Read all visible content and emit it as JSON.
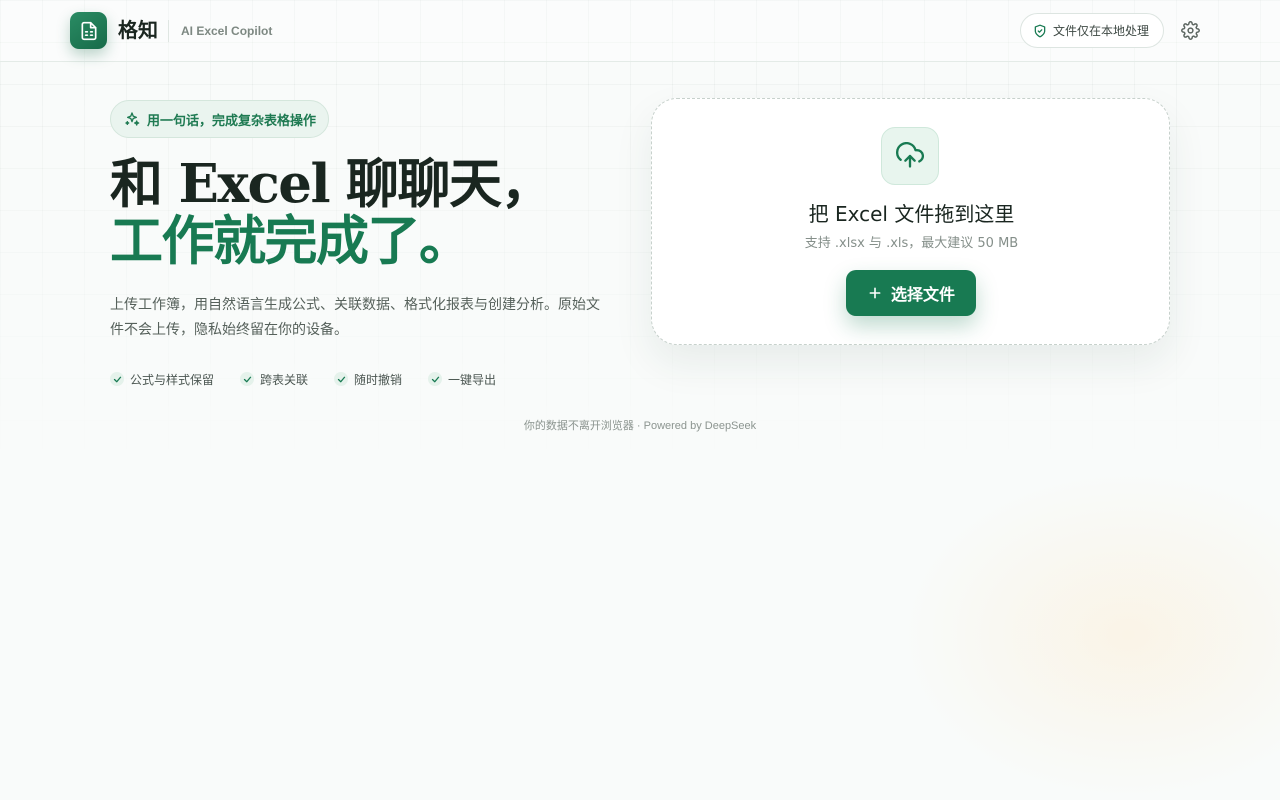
{
  "header": {
    "brand_name": "格知",
    "brand_subtitle": "AI Excel Copilot",
    "logo_icon": "spreadsheet-icon",
    "local_badge": "文件仅在本地处理",
    "local_badge_icon": "shield-check-icon",
    "settings_icon": "gear-icon"
  },
  "hero": {
    "tag": "用一句话，完成复杂表格操作",
    "tag_icon": "sparkles-icon",
    "headline_line1": "和 Excel 聊聊天，",
    "headline_line2": "工作就完成了。",
    "description": "上传工作簿，用自然语言生成公式、关联数据、格式化报表与创建分析。原始文件不会上传，隐私始终留在你的设备。",
    "features": [
      {
        "label": "公式与样式保留",
        "icon": "check-icon"
      },
      {
        "label": "跨表关联",
        "icon": "check-icon"
      },
      {
        "label": "随时撤销",
        "icon": "check-icon"
      },
      {
        "label": "一键导出",
        "icon": "check-icon"
      }
    ]
  },
  "upload": {
    "icon": "cloud-upload-icon",
    "title": "把 Excel 文件拖到这里",
    "hint": "支持 .xlsx 与 .xls，最大建议 50 MB",
    "button_label": "选择文件",
    "button_icon": "plus-icon"
  },
  "footer": {
    "note": "你的数据不离开浏览器 · Powered by DeepSeek"
  },
  "colors": {
    "brand_green": "#187a52",
    "text_dark": "#1a2620",
    "tag_bg": "#eaf4ef"
  }
}
